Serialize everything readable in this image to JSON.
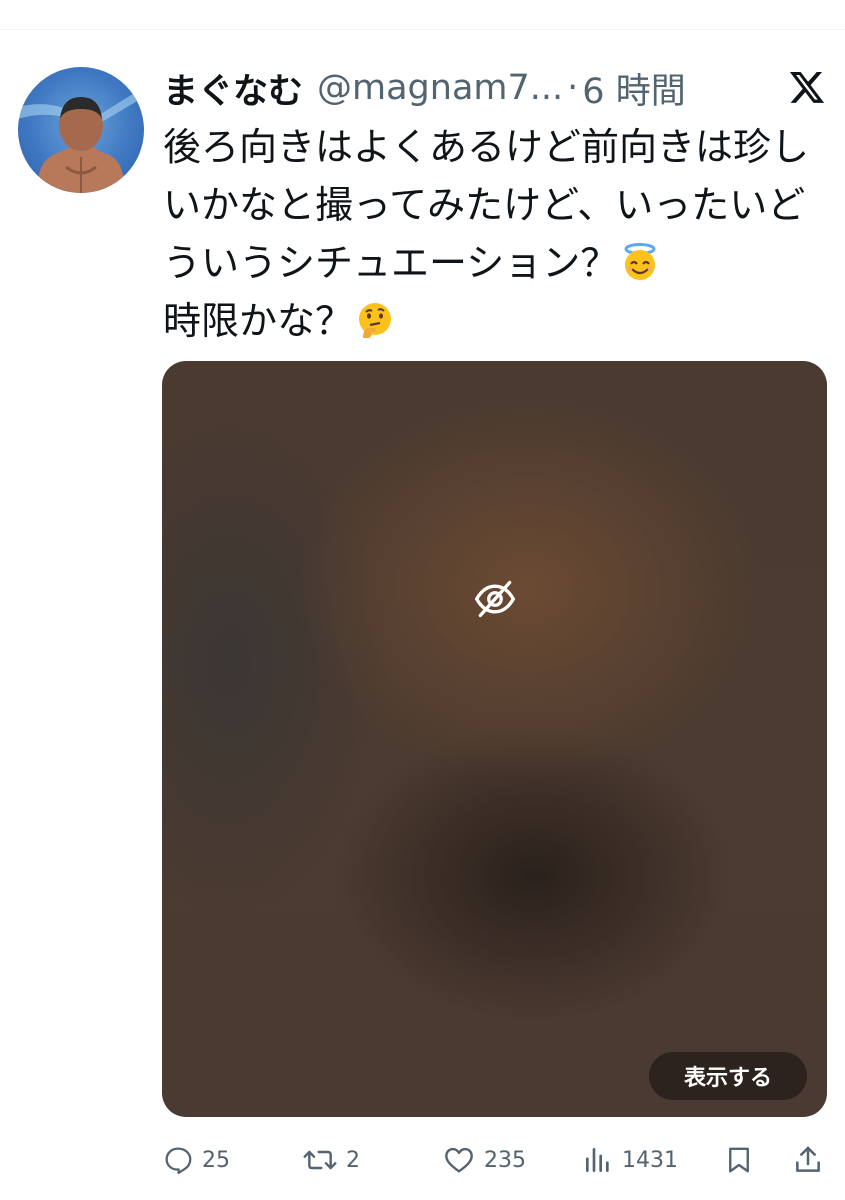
{
  "tweet": {
    "display_name": "まぐなむ",
    "handle": "@magnam7...",
    "separator": "·",
    "time": "6 時間",
    "text_part1": "後ろ向きはよくあるけど前向きは珍しいかなと撮ってみたけど、いったいどういうシチュエーション？",
    "emoji1": "smiling-face-with-halo",
    "text_part2": "時限かな？",
    "emoji2": "thinking-face"
  },
  "media": {
    "sensitive_icon": "eye-slash-icon",
    "show_button_label": "表示する"
  },
  "actions": {
    "replies": "25",
    "retweets": "2",
    "likes": "235",
    "views": "1431"
  },
  "colors": {
    "text": "#0f1419",
    "secondary": "#536471"
  }
}
